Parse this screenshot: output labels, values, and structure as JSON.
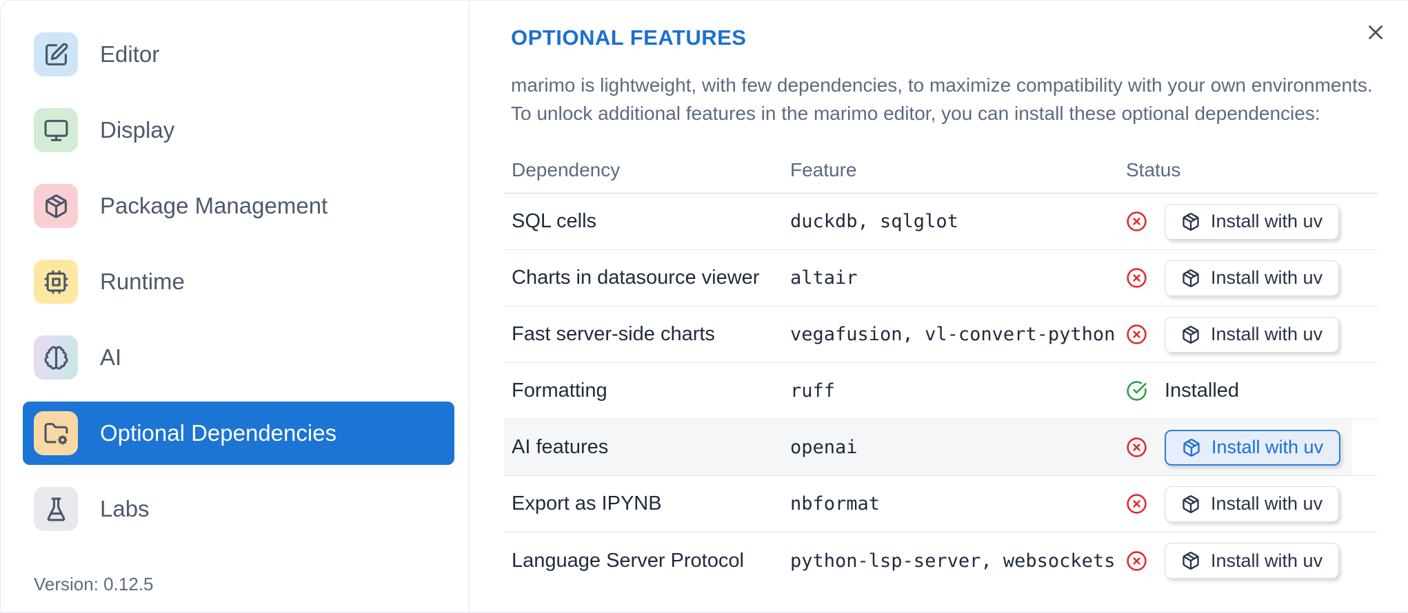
{
  "dialog": {
    "title": "OPTIONAL FEATURES",
    "description": "marimo is lightweight, with few dependencies, to maximize compatibility with your own environments.\nTo unlock additional features in the marimo editor, you can install these optional dependencies:",
    "close_icon": "x-icon"
  },
  "sidebar": {
    "version": "Version: 0.12.5",
    "items": [
      {
        "id": "editor",
        "label": "Editor",
        "icon": "square-pen-icon",
        "icon_bg": "#cde5f7",
        "selected": false
      },
      {
        "id": "display",
        "label": "Display",
        "icon": "monitor-icon",
        "icon_bg": "#d4ecd5",
        "selected": false
      },
      {
        "id": "package-management",
        "label": "Package Management",
        "icon": "package-icon",
        "icon_bg": "#facfd3",
        "selected": false
      },
      {
        "id": "runtime",
        "label": "Runtime",
        "icon": "cpu-icon",
        "icon_bg": "#fce8a0",
        "selected": false
      },
      {
        "id": "ai",
        "label": "AI",
        "icon": "brain-icon",
        "icon_bg": "linear-gradient(105deg, #ead9f2, #d5e2ee 55%, #c7e8e1)",
        "selected": false
      },
      {
        "id": "optional-dependencies",
        "label": "Optional Dependencies",
        "icon": "folder-cog-icon",
        "icon_bg": "#f9d8a5",
        "selected": true
      },
      {
        "id": "labs",
        "label": "Labs",
        "icon": "flask-icon",
        "icon_bg": "#e8e9ec",
        "selected": false
      }
    ]
  },
  "table": {
    "headers": [
      "Dependency",
      "Feature",
      "Status"
    ],
    "install_label": "Install with uv",
    "installed_label": "Installed",
    "status_icons": {
      "not_installed": "circle-x-icon",
      "installed": "circle-check-icon"
    },
    "button_icon": "package-icon",
    "rows": [
      {
        "dependency": "SQL cells",
        "feature": "duckdb, sqlglot",
        "installed": false,
        "highlighted": false
      },
      {
        "dependency": "Charts in datasource viewer",
        "feature": "altair",
        "installed": false,
        "highlighted": false
      },
      {
        "dependency": "Fast server-side charts",
        "feature": "vegafusion, vl-convert-python",
        "installed": false,
        "highlighted": false
      },
      {
        "dependency": "Formatting",
        "feature": "ruff",
        "installed": true,
        "highlighted": false
      },
      {
        "dependency": "AI features",
        "feature": "openai",
        "installed": false,
        "highlighted": true
      },
      {
        "dependency": "Export as IPYNB",
        "feature": "nbformat",
        "installed": false,
        "highlighted": false
      },
      {
        "dependency": "Language Server Protocol",
        "feature": "python-lsp-server, websockets",
        "installed": false,
        "highlighted": false
      }
    ]
  },
  "colors": {
    "accent_blue": "#1c74d4",
    "title_blue": "#1a6fd4",
    "status_red": "#df2b2b",
    "status_green": "#2f9e44",
    "highlight_row_bg": "#f5f6f8"
  }
}
